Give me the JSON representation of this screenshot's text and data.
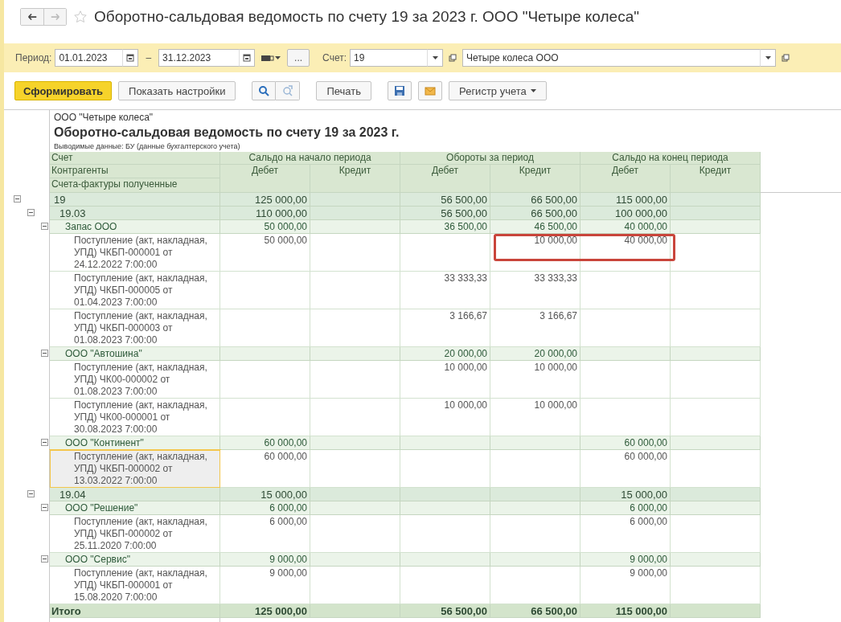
{
  "window": {
    "title": "Оборотно-сальдовая ведомость по счету 19 за 2023 г. ООО \"Четыре колеса\""
  },
  "nav_buttons": [
    {
      "kind": "back",
      "disabled": false
    },
    {
      "kind": "forward",
      "disabled": true
    }
  ],
  "filters": {
    "period_label": "Период:",
    "date_from": "01.01.2023",
    "separator": "–",
    "date_to": "31.12.2023",
    "more_button": "...",
    "account_label": "Счет:",
    "account": "19",
    "organization": "Четыре колеса ООО"
  },
  "toolbar": [
    {
      "kind": "primary",
      "label": "Сформировать"
    },
    {
      "kind": "text",
      "label": "Показать настройки"
    },
    {
      "kind": "search"
    },
    {
      "kind": "search-next"
    },
    {
      "kind": "text",
      "label": "Печать"
    },
    {
      "kind": "save"
    },
    {
      "kind": "mail"
    },
    {
      "kind": "menu",
      "label": "Регистр учета"
    }
  ],
  "report": {
    "company": "ООО \"Четыре колеса\"",
    "title": "Оборотно-сальдовая ведомость по счету 19 за 2023 г.",
    "subtitle": "Выводимые данные: БУ (данные бухгалтерского учета)",
    "row_labels": [
      "Счет",
      "Контрагенты",
      "Счета-фактуры полученные"
    ],
    "column_groups": [
      {
        "label": "Сальдо на начало периода",
        "columns": [
          "Дебет",
          "Кредит"
        ]
      },
      {
        "label": "Обороты за период",
        "columns": [
          "Дебет",
          "Кредит"
        ]
      },
      {
        "label": "Сальдо на конец периода",
        "columns": [
          "Дебет",
          "Кредит"
        ]
      }
    ],
    "rows": [
      {
        "kind": "account",
        "name": "19",
        "expanded": true,
        "values": {
          "debit_start": "125 000,00",
          "debit_turnover": "56 500,00",
          "credit_turnover": "66 500,00",
          "debit_end": "115 000,00"
        },
        "children": [
          {
            "kind": "account",
            "name": "19.03",
            "expanded": true,
            "values": {
              "debit_start": "110 000,00",
              "debit_turnover": "56 500,00",
              "credit_turnover": "66 500,00",
              "debit_end": "100 000,00"
            },
            "children": [
              {
                "kind": "counterparty",
                "name": "Запас ООО",
                "expanded": true,
                "values": {
                  "debit_start": "50 000,00",
                  "debit_turnover": "36 500,00",
                  "credit_turnover": "46 500,00",
                  "debit_end": "40 000,00"
                },
                "children": [
                  {
                    "kind": "document",
                    "name": "Поступление (акт, накладная, УПД) ЧКБП-000001 от 24.12.2022 7:00:00",
                    "selected": false,
                    "annotated": true,
                    "values": {
                      "debit_start": "50 000,00",
                      "credit_turnover": "10 000,00",
                      "debit_end": "40 000,00"
                    }
                  },
                  {
                    "kind": "document",
                    "name": "Поступление (акт, накладная, УПД) ЧКБП-000005 от 01.04.2023 7:00:00",
                    "selected": false,
                    "annotated": false,
                    "values": {
                      "debit_turnover": "33 333,33",
                      "credit_turnover": "33 333,33"
                    }
                  },
                  {
                    "kind": "document",
                    "name": "Поступление (акт, накладная, УПД) ЧКБП-000003 от 01.08.2023 7:00:00",
                    "selected": false,
                    "annotated": false,
                    "values": {
                      "debit_turnover": "3 166,67",
                      "credit_turnover": "3 166,67"
                    }
                  }
                ]
              },
              {
                "kind": "counterparty",
                "name": "ООО \"Автошина\"",
                "expanded": true,
                "values": {
                  "debit_turnover": "20 000,00",
                  "credit_turnover": "20 000,00"
                },
                "children": [
                  {
                    "kind": "document",
                    "name": "Поступление (акт, накладная, УПД) ЧК00-000002 от 01.08.2023 7:00:00",
                    "selected": false,
                    "annotated": false,
                    "values": {
                      "debit_turnover": "10 000,00",
                      "credit_turnover": "10 000,00"
                    }
                  },
                  {
                    "kind": "document",
                    "name": "Поступление (акт, накладная, УПД) ЧК00-000001 от 30.08.2023 7:00:00",
                    "selected": false,
                    "annotated": false,
                    "values": {
                      "debit_turnover": "10 000,00",
                      "credit_turnover": "10 000,00"
                    }
                  }
                ]
              },
              {
                "kind": "counterparty",
                "name": "ООО \"Континент\"",
                "expanded": true,
                "values": {
                  "debit_start": "60 000,00",
                  "debit_end": "60 000,00"
                },
                "children": [
                  {
                    "kind": "document",
                    "name": "Поступление (акт, накладная, УПД) ЧКБП-000002 от 13.03.2022 7:00:00",
                    "selected": true,
                    "annotated": false,
                    "values": {
                      "debit_start": "60 000,00",
                      "debit_end": "60 000,00"
                    }
                  }
                ]
              }
            ]
          },
          {
            "kind": "account",
            "name": "19.04",
            "expanded": true,
            "values": {
              "debit_start": "15 000,00",
              "debit_end": "15 000,00"
            },
            "children": [
              {
                "kind": "counterparty",
                "name": "ООО \"Решение\"",
                "expanded": true,
                "values": {
                  "debit_start": "6 000,00",
                  "debit_end": "6 000,00"
                },
                "children": [
                  {
                    "kind": "document",
                    "name": "Поступление (акт, накладная, УПД) ЧКБП-000002 от 25.11.2020 7:00:00",
                    "selected": false,
                    "annotated": false,
                    "values": {
                      "debit_start": "6 000,00",
                      "debit_end": "6 000,00"
                    }
                  }
                ]
              },
              {
                "kind": "counterparty",
                "name": "ООО \"Сервис\"",
                "expanded": true,
                "values": {
                  "debit_start": "9 000,00",
                  "debit_end": "9 000,00"
                },
                "children": [
                  {
                    "kind": "document",
                    "name": "Поступление (акт, накладная, УПД) ЧКБП-000001 от 15.08.2020 7:00:00",
                    "selected": false,
                    "annotated": false,
                    "values": {
                      "debit_start": "9 000,00",
                      "debit_end": "9 000,00"
                    }
                  }
                ]
              }
            ]
          }
        ]
      },
      {
        "kind": "total",
        "name": "Итого",
        "values": {
          "debit_start": "125 000,00",
          "debit_turnover": "56 500,00",
          "credit_turnover": "66 500,00",
          "debit_end": "115 000,00"
        }
      }
    ]
  }
}
